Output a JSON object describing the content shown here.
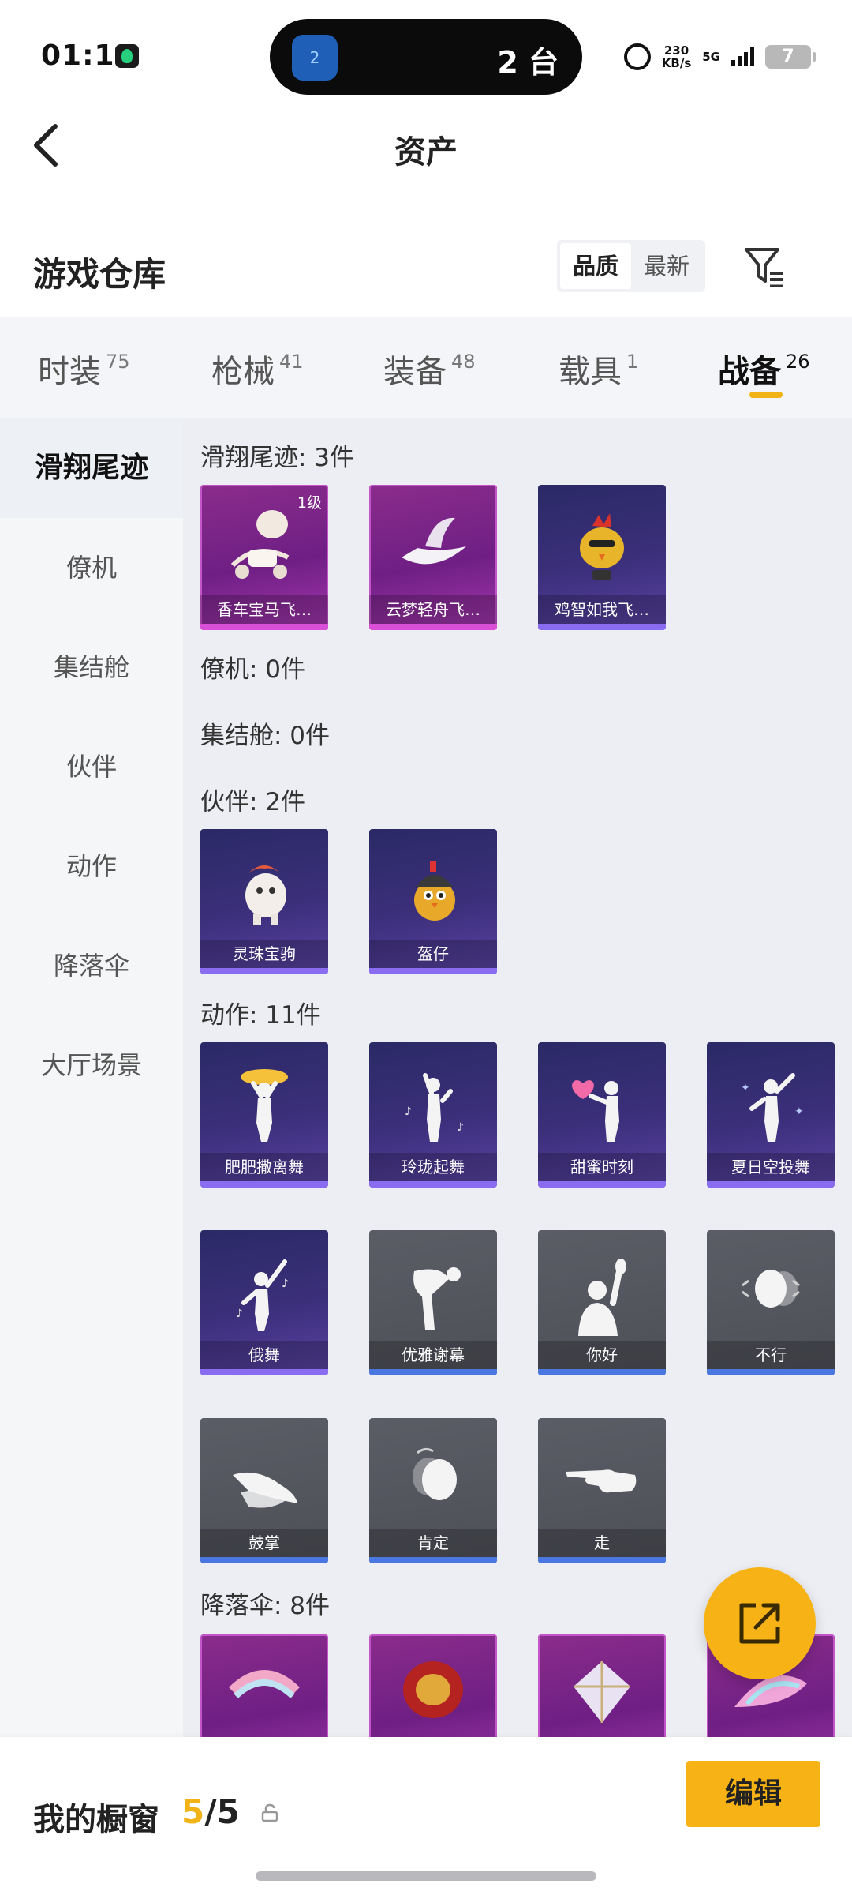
{
  "status_bar": {
    "time": "01:11",
    "island_icon_text": "2",
    "island_text": "2 台",
    "speed_value": "230",
    "speed_unit": "KB/s",
    "network": "5G",
    "battery": "7"
  },
  "header": {
    "title": "资产"
  },
  "section": {
    "title": "游戏仓库",
    "sort_options": [
      "品质",
      "最新"
    ]
  },
  "tabs": [
    {
      "label": "时装",
      "count": "75"
    },
    {
      "label": "枪械",
      "count": "41"
    },
    {
      "label": "装备",
      "count": "48"
    },
    {
      "label": "载具",
      "count": "1"
    },
    {
      "label": "战备",
      "count": "26"
    }
  ],
  "sidebar": {
    "items": [
      "滑翔尾迹",
      "僚机",
      "集结舱",
      "伙伴",
      "动作",
      "降落伞",
      "大厅场景"
    ]
  },
  "groups": {
    "trail": {
      "title": "滑翔尾迹: 3件",
      "items": [
        {
          "name": "香车宝马飞…",
          "level": "1级"
        },
        {
          "name": "云梦轻舟飞…"
        },
        {
          "name": "鸡智如我飞…"
        }
      ]
    },
    "wingman": {
      "title": "僚机: 0件"
    },
    "pod": {
      "title": "集结舱: 0件"
    },
    "companion": {
      "title": "伙伴: 2件",
      "items": [
        {
          "name": "灵珠宝驹"
        },
        {
          "name": "盔仔"
        }
      ]
    },
    "emote": {
      "title": "动作: 11件",
      "items": [
        {
          "name": "肥肥撒离舞"
        },
        {
          "name": "玲珑起舞"
        },
        {
          "name": "甜蜜时刻"
        },
        {
          "name": "夏日空投舞"
        },
        {
          "name": "俄舞"
        },
        {
          "name": "优雅谢幕"
        },
        {
          "name": "你好"
        },
        {
          "name": "不行"
        },
        {
          "name": "鼓掌"
        },
        {
          "name": "肯定"
        },
        {
          "name": "走"
        }
      ]
    },
    "parachute": {
      "title": "降落伞: 8件"
    }
  },
  "bottom": {
    "label": "我的橱窗",
    "current": "5",
    "separator": "/",
    "total": "5",
    "edit_label": "编辑"
  },
  "colors": {
    "accent": "#f7b316",
    "rare_pink": "#d94fd6",
    "epic_blue": "#8a6cf0",
    "common_gray": "#4a78e0"
  }
}
